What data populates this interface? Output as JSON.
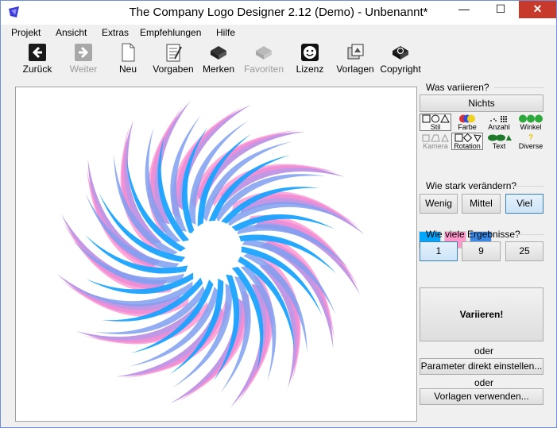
{
  "window": {
    "title": "The Company Logo Designer 2.12 (Demo) - Unbenannt*",
    "minimize": "—",
    "maximize": "☐",
    "close": "✕"
  },
  "menu": [
    "Projekt",
    "Ansicht",
    "Extras",
    "Empfehlungen",
    "Hilfe"
  ],
  "toolbar": {
    "back": "Zurück",
    "forward": "Weiter",
    "new": "Neu",
    "presets": "Vorgaben",
    "remember": "Merken",
    "favorites": "Favoriten",
    "license": "Lizenz",
    "templates": "Vorlagen",
    "copyright": "Copyright"
  },
  "panel": {
    "vary_label": "Was variieren?",
    "nothing": "Nichts",
    "categories": {
      "style": "Stil",
      "color": "Farbe",
      "count": "Anzahl",
      "angle": "Winkel",
      "camera": "Kamera",
      "rotation": "Rotation",
      "text": "Text",
      "misc": "Diverse"
    },
    "swatch_colors": [
      "#00a6ff",
      "#ff99cc",
      "#3b8ae6"
    ],
    "strength_label": "Wie stark verändern?",
    "strength": {
      "low": "Wenig",
      "mid": "Mittel",
      "high": "Viel",
      "selected": "Viel"
    },
    "results_label": "Wie viele Ergebnisse?",
    "results": {
      "one": "1",
      "nine": "9",
      "twentyfive": "25",
      "selected": "1"
    },
    "vary_button": "Variieren!",
    "or1": "oder",
    "params_button": "Parameter direkt einstellen...",
    "or2": "oder",
    "templates_button": "Vorlagen verwenden..."
  },
  "logo": {
    "colors": {
      "blue": "#1aa3ff",
      "pink": "#ff8ccf",
      "violet": "#b07ee0",
      "periwinkle": "#7f9ff0"
    }
  }
}
